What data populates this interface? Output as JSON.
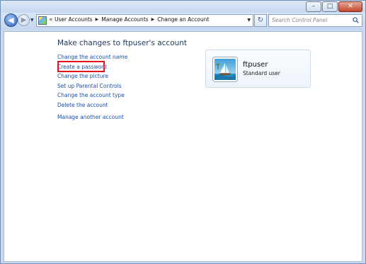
{
  "window": {
    "controls": {
      "minimize": "–",
      "maximize": "□",
      "close": "✕"
    }
  },
  "nav": {
    "back_icon": "back-arrow-icon",
    "forward_icon": "forward-arrow-icon"
  },
  "address": {
    "overflow": "«",
    "breadcrumbs": [
      "User Accounts",
      "Manage Accounts",
      "Change an Account"
    ],
    "separator": "▶"
  },
  "search": {
    "placeholder": "Search Control Panel"
  },
  "page": {
    "heading": "Make changes to ftpuser's account",
    "tasks": [
      "Change the account name",
      "Create a password",
      "Change the picture",
      "Set up Parental Controls",
      "Change the account type",
      "Delete the account"
    ],
    "other_task": "Manage another account",
    "highlighted_task": "Create a password"
  },
  "account": {
    "name": "ftpuser",
    "type": "Standard user",
    "picture_icon": "sailboat-picture-icon"
  },
  "colors": {
    "link": "#1a4fa8",
    "heading": "#1e395b",
    "highlight_border": "#e1141b",
    "chrome": "#c9daf0"
  }
}
